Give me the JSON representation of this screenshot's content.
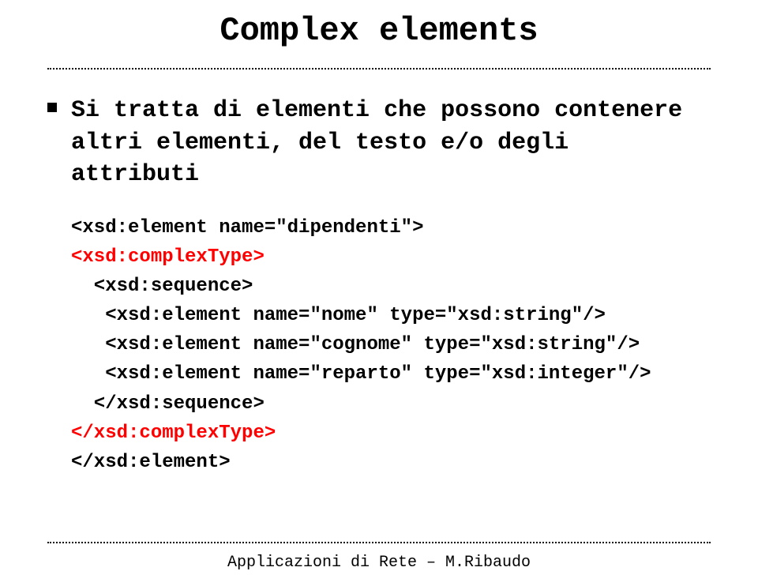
{
  "title": "Complex elements",
  "bullet": "Si tratta di elementi che possono contenere altri elementi, del testo e/o degli attributi",
  "code": {
    "l1": "<xsd:element name=\"dipendenti\">",
    "l2": "<xsd:complexType>",
    "l3": "  <xsd:sequence>",
    "l4": "   <xsd:element name=\"nome\" type=\"xsd:string\"/>",
    "l5": "   <xsd:element name=\"cognome\" type=\"xsd:string\"/>",
    "l6": "   <xsd:element name=\"reparto\" type=\"xsd:integer\"/>",
    "l7": "  </xsd:sequence>",
    "l8": "</xsd:complexType>",
    "l9": "</xsd:element>"
  },
  "footer": "Applicazioni di Rete – M.Ribaudo"
}
